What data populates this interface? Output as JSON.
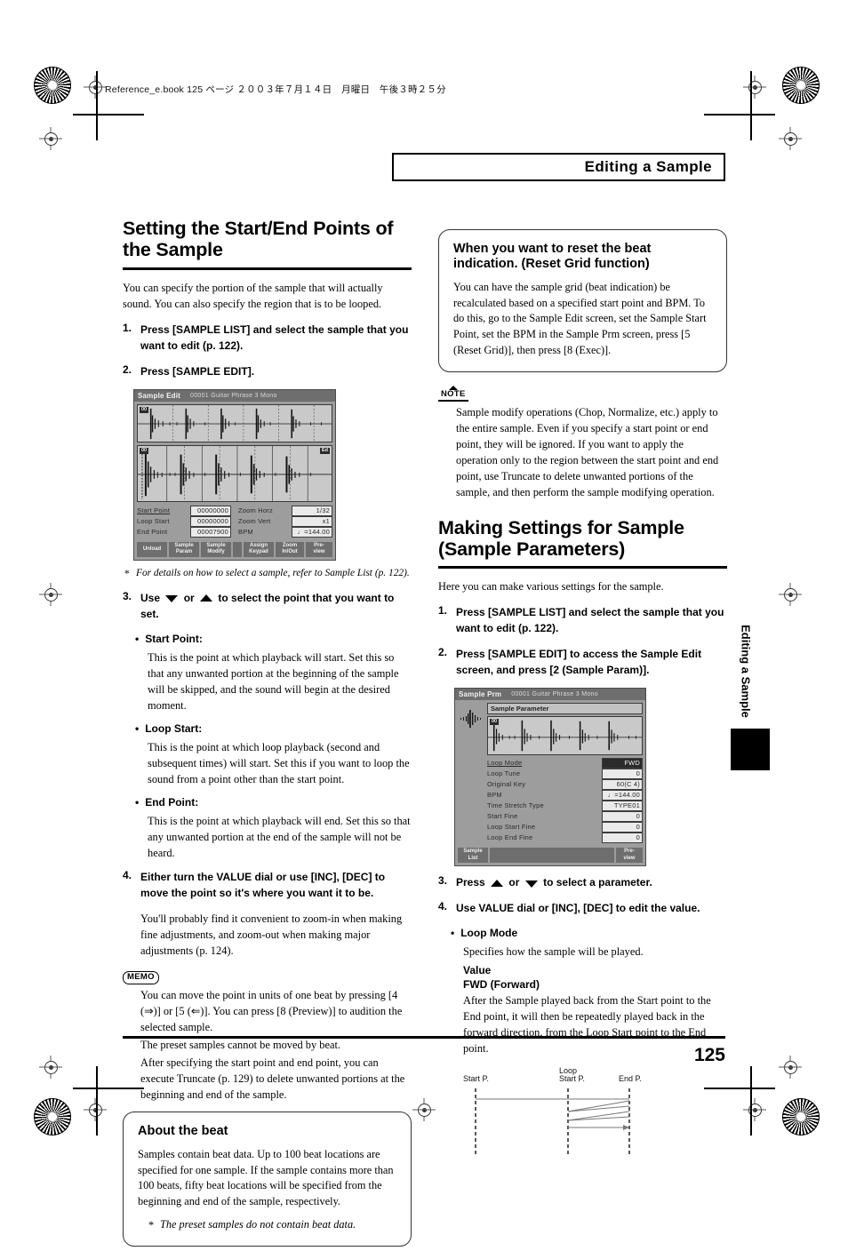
{
  "page": {
    "running_header": "Reference_e.book 125 ページ ２００３年７月１４日　月曜日　午後３時２５分",
    "chapter_title": "Editing a Sample",
    "thumb_tab_label": "Editing a Sample",
    "page_number": "125"
  },
  "left": {
    "section1": {
      "heading": "Setting the Start/End Points of the Sample",
      "intro": "You can specify the portion of the sample that will actually sound. You can also specify the region that is to be looped.",
      "steps": [
        {
          "num": "1.",
          "text": "Press [SAMPLE LIST] and select the sample that you want to edit (p. 122)."
        },
        {
          "num": "2.",
          "text": "Press [SAMPLE EDIT]."
        }
      ],
      "screen_footnote": "For details on how to select a sample, refer to Sample List (p. 122).",
      "step3_pre": "Use",
      "step3_or": "or",
      "step3_post": "to select the point that you want to set.",
      "step3_num": "3.",
      "bullets": [
        {
          "label": "Start Point:",
          "text": "This is the point at which playback will start. Set this so that any unwanted portion at the beginning of the sample will be skipped, and the sound will begin at the desired moment."
        },
        {
          "label": "Loop Start:",
          "text": "This is the point at which loop playback (second and subsequent times) will start. Set this if you want to loop the sound from a point other than the start point."
        },
        {
          "label": "End Point:",
          "text": "This is the point at which playback will end. Set this so that any unwanted portion at the end of the sample will not be heard."
        }
      ],
      "step4_num": "4.",
      "step4_text": "Either turn the VALUE dial or use [INC], [DEC] to move the point so it's where you want it to be.",
      "step4_body": "You'll probably find it convenient to zoom-in when making fine adjustments, and zoom-out when making major adjustments (p. 124).",
      "memo_badge": "MEMO",
      "memo_paras": [
        "You can move the point in units of one beat by pressing [4 (⇒)] or [5 (⇐)]. You can press [8 (Preview)] to audition the selected sample.",
        "The preset samples cannot be moved by beat.",
        "After specifying the start point and end point, you can execute Truncate (p. 129) to delete unwanted portions at the beginning and end of the sample."
      ]
    },
    "about_beat_box": {
      "heading": "About the beat",
      "para": "Samples contain beat data. Up to 100 beat locations are specified for one sample. If the sample contains more than 100 beats, fifty beat locations will be specified from the beginning and end of the sample, respectively.",
      "footnote": "The preset samples do not contain beat data."
    }
  },
  "right": {
    "reset_grid_box": {
      "heading": "When you want to reset the beat indication. (Reset Grid function)",
      "para": "You can have the sample grid (beat indication) be recalculated based on a specified start point and BPM. To do this, go to the Sample Edit screen, set the Sample Start Point, set the BPM in the Sample Prm screen, press [5 (Reset Grid)], then press [8 (Exec)]."
    },
    "note_badge": "NOTE",
    "note_text": "Sample modify operations (Chop, Normalize, etc.) apply to the entire sample. Even if you specify a start point or end point, they will be ignored. If you want to apply the operation only to the region between the start point and end point, use Truncate to delete unwanted portions of the sample, and then perform the sample modifying operation.",
    "section2": {
      "heading": "Making Settings for Sample (Sample Parameters)",
      "intro": "Here you can make various settings for the sample.",
      "steps": [
        {
          "num": "1.",
          "text": "Press [SAMPLE LIST] and select the sample that you want to edit (p. 122)."
        },
        {
          "num": "2.",
          "text": "Press [SAMPLE EDIT] to access the Sample Edit screen, and press [2 (Sample Param)]."
        }
      ],
      "step3_num": "3.",
      "step3_pre": "Press",
      "step3_or": "or",
      "step3_post": "to select a parameter.",
      "step4_num": "4.",
      "step4_text": "Use VALUE dial or [INC], [DEC] to edit the value.",
      "loop_mode_label": "Loop Mode",
      "loop_mode_desc": "Specifies how the sample will be played.",
      "value_label": "Value",
      "fwd_label": "FWD (Forward)",
      "fwd_desc": "After the Sample played back from the Start point to the End point, it will then be repeatedly played back in the forward direction, from the Loop Start point to the End point."
    },
    "loop_diagram": {
      "start_label": "Start P.",
      "loop_start_label_line1": "Loop",
      "loop_start_label_line2": "Start P.",
      "end_label": "End P."
    }
  },
  "lcd_sample_edit": {
    "title": "Sample Edit",
    "subtitle": "00001 Guitar Phrase   3 Mono",
    "overview_tag": "00",
    "detail_tag_left": "00",
    "detail_tag_right": "Ed",
    "params": [
      {
        "label": "Start Point",
        "value": "00000000",
        "selected": true
      },
      {
        "label": "Loop Start",
        "value": "00000000",
        "selected": false
      },
      {
        "label": "End Point",
        "value": "00007900",
        "selected": false
      }
    ],
    "params_right": [
      {
        "label": "Zoom Horz",
        "value": "1/32"
      },
      {
        "label": "Zoom Vert",
        "value": "x1"
      },
      {
        "label": "BPM",
        "value": "♩=144.00"
      }
    ],
    "softkeys": [
      {
        "line1": "Unload",
        "line2": ""
      },
      {
        "line1": "Sample",
        "line2": "Param"
      },
      {
        "line1": "Sample",
        "line2": "Modify"
      },
      {
        "line1": "Assign",
        "line2": "Keypad"
      },
      {
        "line1": "Zoom",
        "line2": "In/Out"
      },
      {
        "line1": "Pre-",
        "line2": "view"
      }
    ]
  },
  "lcd_sample_prm": {
    "title": "Sample Prm",
    "subtitle": "00001 Guitar Phrase   3 Mono",
    "panel_title": "Sample Parameter",
    "wave_tag": "00",
    "params": [
      {
        "label": "Loop Mode",
        "value": "FWD",
        "selected": true,
        "inverted": true
      },
      {
        "label": "Loop Tune",
        "value": "0",
        "selected": false,
        "inverted": false
      },
      {
        "label": "Original Key",
        "value": "60(C 4)",
        "selected": false,
        "inverted": false
      },
      {
        "label": "BPM",
        "value": "♩=144.00",
        "selected": false,
        "inverted": false
      },
      {
        "label": "Time Stretch Type",
        "value": "TYPE01",
        "selected": false,
        "inverted": false
      },
      {
        "label": "Start Fine",
        "value": "0",
        "selected": false,
        "inverted": false
      },
      {
        "label": "Loop Start Fine",
        "value": "0",
        "selected": false,
        "inverted": false
      },
      {
        "label": "Loop End Fine",
        "value": "0",
        "selected": false,
        "inverted": false
      }
    ],
    "softkeys": [
      {
        "line1": "Sample",
        "line2": "List"
      },
      {
        "line1": "Pre-",
        "line2": "view"
      }
    ]
  }
}
